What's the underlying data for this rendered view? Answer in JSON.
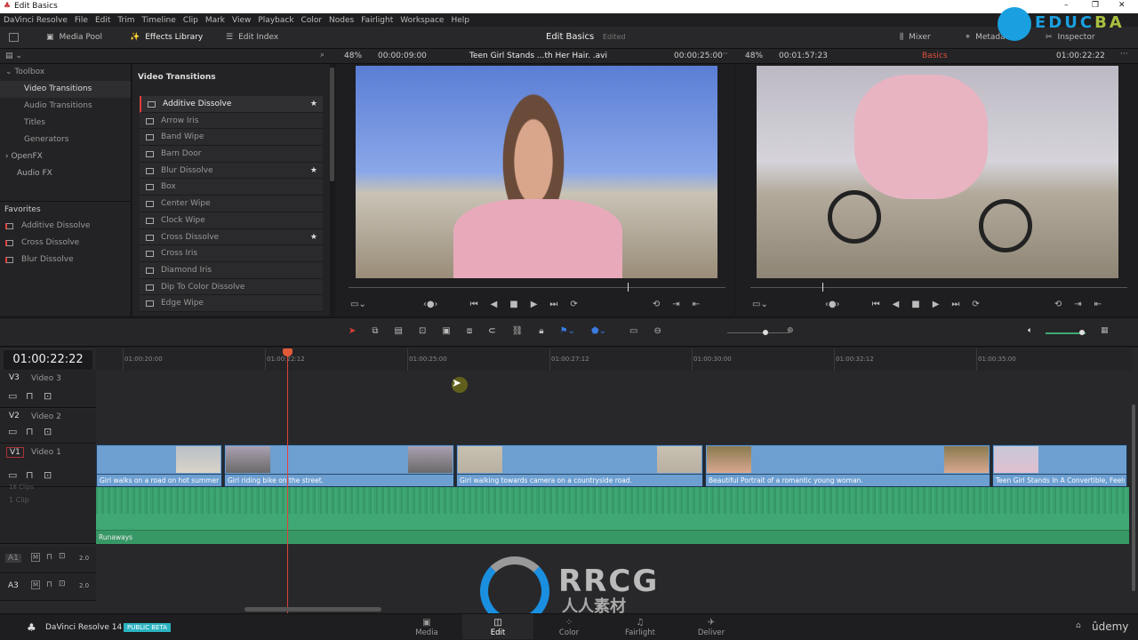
{
  "window": {
    "title": "Edit Basics",
    "controls": [
      "–",
      "❐",
      "✕"
    ]
  },
  "menu": [
    "DaVinci Resolve",
    "File",
    "Edit",
    "Trim",
    "Timeline",
    "Clip",
    "Mark",
    "View",
    "Playback",
    "Color",
    "Nodes",
    "Fairlight",
    "Workspace",
    "Help"
  ],
  "toolbar": {
    "media_pool": "Media Pool",
    "effects_library": "Effects Library",
    "edit_index": "Edit Index",
    "project_title": "Edit Basics",
    "project_status": "Edited",
    "mixer": "Mixer",
    "metadata": "Metadata",
    "inspector": "Inspector"
  },
  "watermark": {
    "educba": "EDUCBA",
    "rrcg": "RRCG",
    "rrcg_sub": "人人素材",
    "udemy": "ûdemy"
  },
  "toolbox": {
    "header": "Toolbox",
    "items": [
      "Video Transitions",
      "Audio Transitions",
      "Titles",
      "Generators"
    ],
    "openfx": "OpenFX",
    "audiofx": "Audio FX",
    "favorites_header": "Favorites",
    "favorites": [
      "Additive Dissolve",
      "Cross Dissolve",
      "Blur Dissolve"
    ]
  },
  "transitions": {
    "header": "Video Transitions",
    "items": [
      {
        "name": "Additive Dissolve",
        "fav": true
      },
      {
        "name": "Arrow Iris",
        "fav": false
      },
      {
        "name": "Band Wipe",
        "fav": false
      },
      {
        "name": "Barn Door",
        "fav": false
      },
      {
        "name": "Blur Dissolve",
        "fav": true
      },
      {
        "name": "Box",
        "fav": false
      },
      {
        "name": "Center Wipe",
        "fav": false
      },
      {
        "name": "Clock Wipe",
        "fav": false
      },
      {
        "name": "Cross Dissolve",
        "fav": true
      },
      {
        "name": "Cross Iris",
        "fav": false
      },
      {
        "name": "Diamond Iris",
        "fav": false
      },
      {
        "name": "Dip To Color Dissolve",
        "fav": false
      },
      {
        "name": "Edge Wipe",
        "fav": false
      }
    ]
  },
  "source_viewer": {
    "zoom": "48%",
    "duration": "00:00:09:00",
    "clip_name": "Teen Girl Stands ...th Her Hair. .avi",
    "timecode": "00:00:25:00",
    "scrub_position": 0.74
  },
  "timeline_viewer": {
    "zoom": "48%",
    "duration": "00:01:57:23",
    "timeline_name": "Basics",
    "timecode": "01:00:22:22",
    "scrub_position": 0.19
  },
  "timeline": {
    "timecode": "01:00:22:22",
    "ruler": [
      "01:00:20:00",
      "01:00:22:12",
      "01:00:25:00",
      "01:00:27:12",
      "01:00:30:00",
      "01:00:32:12",
      "01:00:35:00"
    ],
    "tracks": [
      {
        "id": "V3",
        "name": "Video 3"
      },
      {
        "id": "V2",
        "name": "Video 2"
      },
      {
        "id": "V1",
        "name": "Video 1"
      }
    ],
    "clips": [
      "Girl walks on a road on hot summer",
      "Girl riding bike on the street.",
      "Girl walking towards camera on a countryside road.",
      "Beautiful Portrait of a romantic young woman.",
      "Teen Girl Stands In A Convertible, Feels T..."
    ],
    "audio_clip": "Runaways",
    "audio_tracks": [
      {
        "id": "A1",
        "m": "M",
        "ch": "2.0"
      },
      {
        "id": "A3",
        "m": "M",
        "ch": "2.0"
      }
    ],
    "v1_clips": "18 Clips",
    "a_clips": "1 Clip"
  },
  "bottom": {
    "app": "DaVinci Resolve 14",
    "badge": "PUBLIC BETA",
    "pages": [
      "Media",
      "Edit",
      "Color",
      "Fairlight",
      "Deliver"
    ],
    "active": "Edit"
  },
  "colors": {
    "accent": "#e0403a",
    "clip": "#6d9fd1",
    "audio": "#3fa874",
    "badge": "#2bb3c0"
  }
}
